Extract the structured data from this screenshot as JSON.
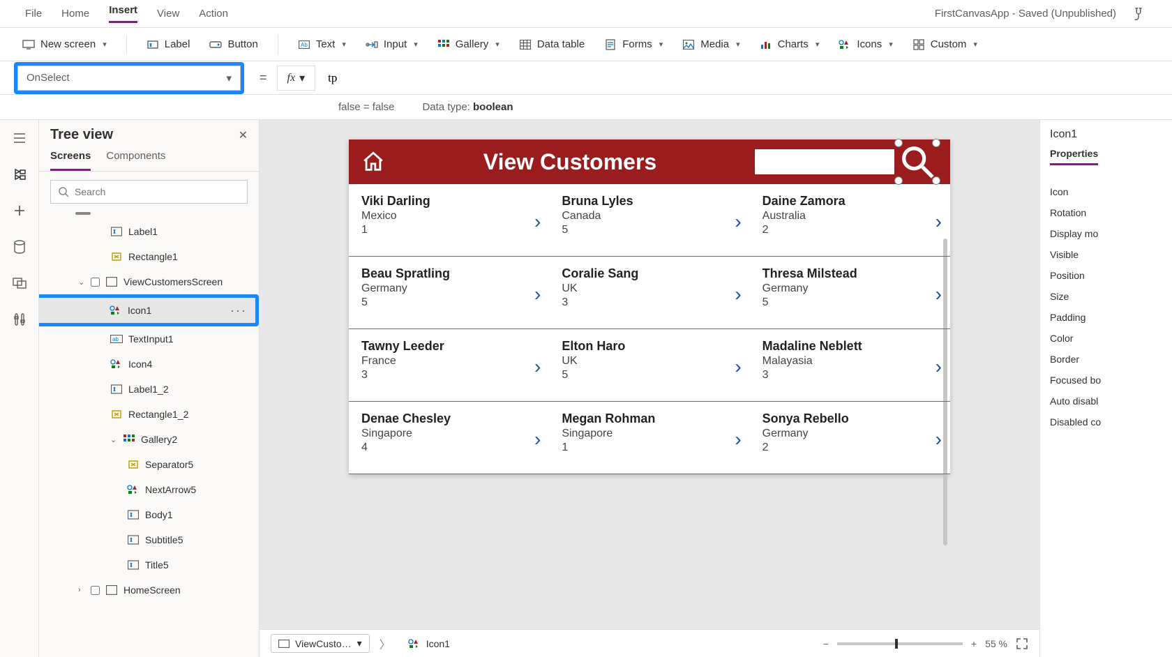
{
  "menubar": {
    "items": [
      "File",
      "Home",
      "Insert",
      "View",
      "Action"
    ],
    "active_index": 2,
    "title": "FirstCanvasApp - Saved (Unpublished)"
  },
  "ribbon": {
    "new_screen": "New screen",
    "label": "Label",
    "button": "Button",
    "text": "Text",
    "input": "Input",
    "gallery": "Gallery",
    "data_table": "Data table",
    "forms": "Forms",
    "media": "Media",
    "charts": "Charts",
    "icons": "Icons",
    "custom": "Custom"
  },
  "formula": {
    "property": "OnSelect",
    "equals": "=",
    "value": "tp",
    "hint_left": "false  =  false",
    "hint_right_label": "Data type: ",
    "hint_right_value": "boolean"
  },
  "treeview": {
    "title": "Tree view",
    "tabs": [
      "Screens",
      "Components"
    ],
    "active_tab": 0,
    "search_placeholder": "Search",
    "selected_path": "Icon1",
    "items": [
      {
        "label": "Label1",
        "icon": "label",
        "depth": 1
      },
      {
        "label": "Rectangle1",
        "icon": "rect",
        "depth": 1
      },
      {
        "label": "ViewCustomersScreen",
        "icon": "screen",
        "depth": 0,
        "caret": "down"
      },
      {
        "label": "Icon1",
        "icon": "icons",
        "depth": 1,
        "selected": true,
        "more": true,
        "highlight": true
      },
      {
        "label": "TextInput1",
        "icon": "textinput",
        "depth": 1
      },
      {
        "label": "Icon4",
        "icon": "icons",
        "depth": 1
      },
      {
        "label": "Label1_2",
        "icon": "label",
        "depth": 1
      },
      {
        "label": "Rectangle1_2",
        "icon": "rect",
        "depth": 1
      },
      {
        "label": "Gallery2",
        "icon": "gallery",
        "depth": 1,
        "caret": "down"
      },
      {
        "label": "Separator5",
        "icon": "rect",
        "depth": 2
      },
      {
        "label": "NextArrow5",
        "icon": "icons",
        "depth": 2
      },
      {
        "label": "Body1",
        "icon": "label",
        "depth": 2
      },
      {
        "label": "Subtitle5",
        "icon": "label",
        "depth": 2
      },
      {
        "label": "Title5",
        "icon": "label",
        "depth": 2
      },
      {
        "label": "HomeScreen",
        "icon": "screen",
        "depth": 0,
        "caret": "right"
      }
    ]
  },
  "app": {
    "title": "View Customers",
    "customers": [
      {
        "name": "Viki  Darling",
        "country": "Mexico",
        "num": "1"
      },
      {
        "name": "Bruna  Lyles",
        "country": "Canada",
        "num": "5"
      },
      {
        "name": "Daine  Zamora",
        "country": "Australia",
        "num": "2"
      },
      {
        "name": "Beau  Spratling",
        "country": "Germany",
        "num": "5"
      },
      {
        "name": "Coralie  Sang",
        "country": "UK",
        "num": "3"
      },
      {
        "name": "Thresa  Milstead",
        "country": "Germany",
        "num": "5"
      },
      {
        "name": "Tawny  Leeder",
        "country": "France",
        "num": "3"
      },
      {
        "name": "Elton  Haro",
        "country": "UK",
        "num": "5"
      },
      {
        "name": "Madaline  Neblett",
        "country": "Malayasia",
        "num": "3"
      },
      {
        "name": "Denae  Chesley",
        "country": "Singapore",
        "num": "4"
      },
      {
        "name": "Megan  Rohman",
        "country": "Singapore",
        "num": "1"
      },
      {
        "name": "Sonya  Rebello",
        "country": "Germany",
        "num": "2"
      }
    ]
  },
  "breadcrumb": {
    "screen": "ViewCusto…",
    "control": "Icon1"
  },
  "zoom": {
    "pct": "55  %"
  },
  "props": {
    "selected": "Icon1",
    "tab": "Properties",
    "rows": [
      "Icon",
      "Rotation",
      "Display mo",
      "Visible",
      "Position",
      "Size",
      "Padding",
      "Color",
      "Border",
      "Focused bo",
      "Auto disabl",
      "Disabled co"
    ]
  }
}
